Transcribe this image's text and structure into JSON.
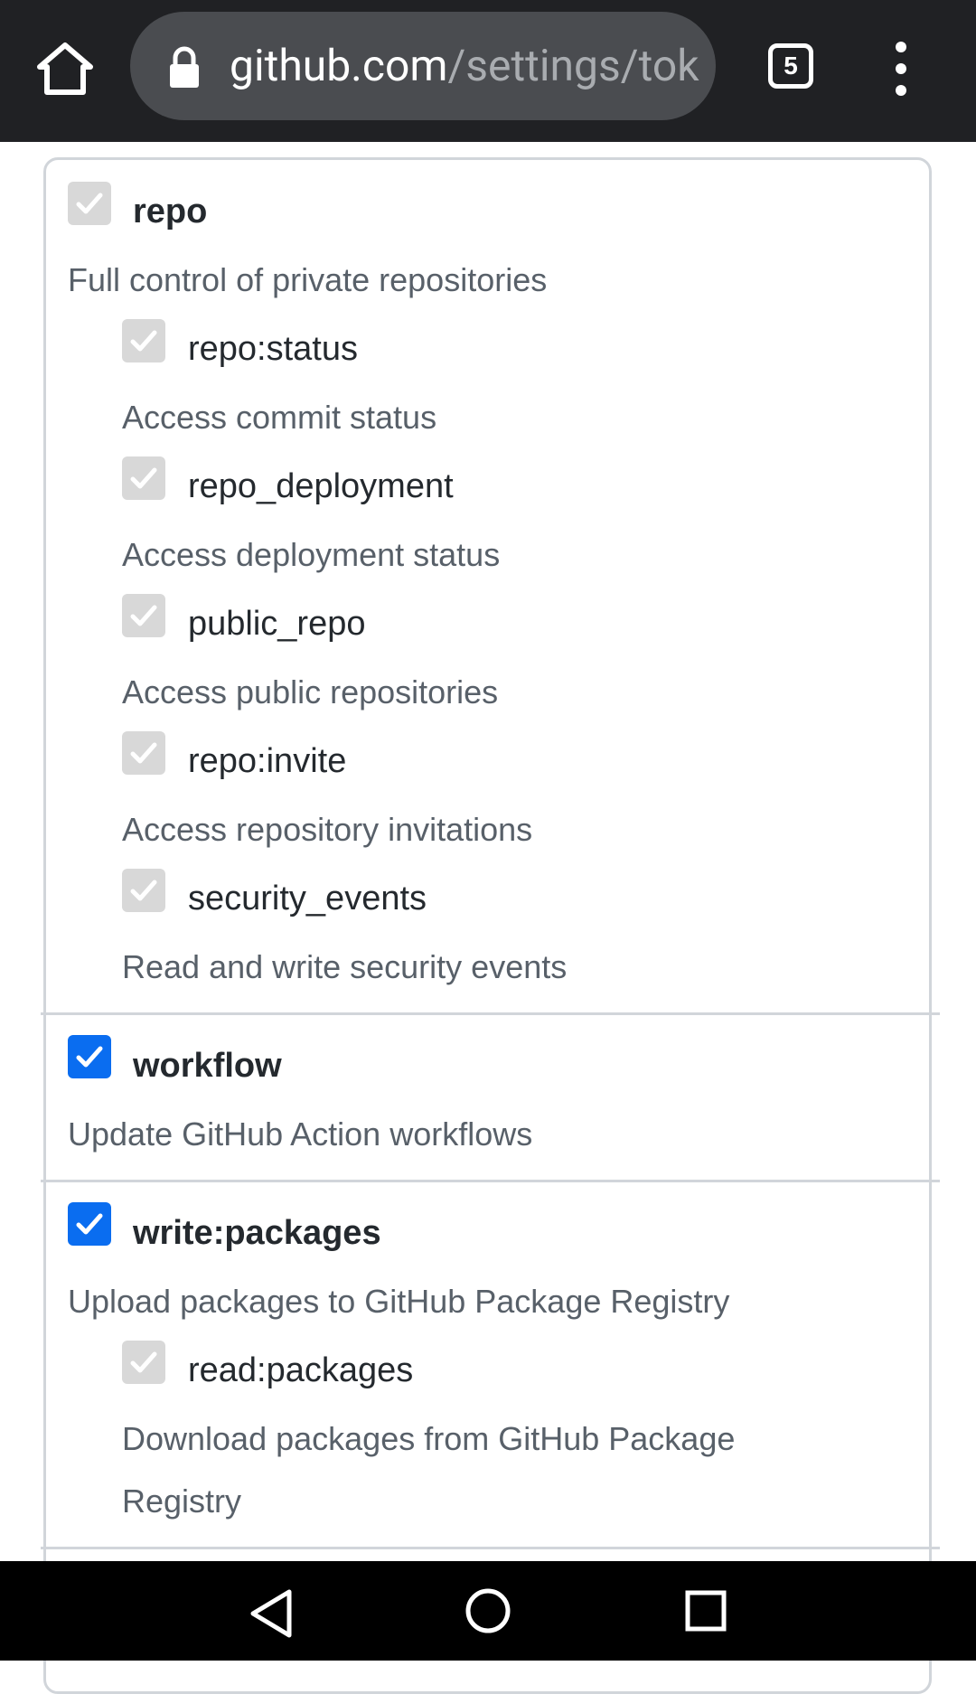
{
  "browser": {
    "url_host": "github.com",
    "url_path": "/settings/tok",
    "tab_count": "5"
  },
  "scopes": {
    "repo": {
      "name": "repo",
      "description": "Full control of private repositories",
      "children": [
        {
          "name": "repo:status",
          "description": "Access commit status"
        },
        {
          "name": "repo_deployment",
          "description": "Access deployment status"
        },
        {
          "name": "public_repo",
          "description": "Access public repositories"
        },
        {
          "name": "repo:invite",
          "description": "Access repository invitations"
        },
        {
          "name": "security_events",
          "description": "Read and write security events"
        }
      ]
    },
    "workflow": {
      "name": "workflow",
      "description": "Update GitHub Action workflows"
    },
    "write_packages": {
      "name": "write:packages",
      "description": "Upload packages to GitHub Package Registry",
      "children": [
        {
          "name": "read:packages",
          "description_line1": "Download packages from GitHub Package",
          "description_line2": "Registry"
        }
      ]
    }
  },
  "colors": {
    "checked": "#0a6df0",
    "disabled": "#d8d8d8",
    "topbar": "#202124"
  }
}
